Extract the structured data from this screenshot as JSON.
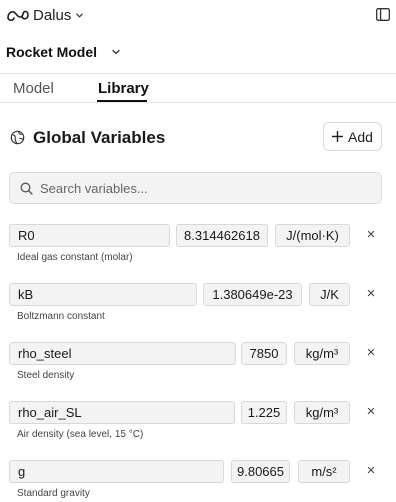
{
  "app": {
    "name": "Dalus"
  },
  "model": {
    "title": "Rocket Model"
  },
  "tabs": [
    {
      "label": "Model",
      "active": false
    },
    {
      "label": "Library",
      "active": true
    }
  ],
  "section": {
    "title": "Global Variables",
    "add_label": "Add"
  },
  "search": {
    "placeholder": "Search variables..."
  },
  "variables": [
    {
      "name": "R0",
      "value": "8.314462618",
      "unit": "J/(mol·K)",
      "description": "Ideal gas constant (molar)"
    },
    {
      "name": "kB",
      "value": "1.380649e-23",
      "unit": "J/K",
      "description": "Boltzmann constant"
    },
    {
      "name": "rho_steel",
      "value": "7850",
      "unit": "kg/m³",
      "description": "Steel density"
    },
    {
      "name": "rho_air_SL",
      "value": "1.225",
      "unit": "kg/m³",
      "description": "Air density (sea level, 15 °C)"
    },
    {
      "name": "g",
      "value": "9.80665",
      "unit": "m/s²",
      "description": "Standard gravity"
    }
  ],
  "icons": {
    "logo": "dalus-logo-icon",
    "app_menu": "chevron-down-icon",
    "panel": "sidebar-toggle-icon",
    "section": "globe-icon",
    "add": "plus-icon",
    "search": "search-icon",
    "remove": "close-icon"
  }
}
